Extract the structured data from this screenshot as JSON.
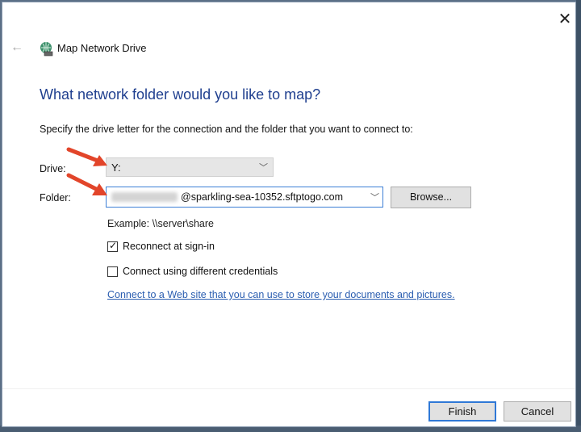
{
  "window": {
    "title": "Map Network Drive",
    "close_glyph": "✕",
    "back_glyph": "←"
  },
  "content": {
    "heading": "What network folder would you like to map?",
    "description": "Specify the drive letter for the connection and the folder that you want to connect to:",
    "drive": {
      "label": "Drive:",
      "value": "Y:"
    },
    "folder": {
      "label": "Folder:",
      "value": "@sparkling-sea-10352.sftptogo.com",
      "browse_label": "Browse..."
    },
    "example": "Example: \\\\server\\share",
    "reconnect": {
      "label": "Reconnect at sign-in",
      "checked": true
    },
    "different_credentials": {
      "label": "Connect using different credentials",
      "checked": false
    },
    "link": "Connect to a Web site that you can use to store your documents and pictures."
  },
  "footer": {
    "finish_label": "Finish",
    "cancel_label": "Cancel"
  },
  "colors": {
    "heading": "#1f3f8f",
    "link": "#2a5db0",
    "focus": "#2f78d6",
    "annotation_arrow": "#e2452a"
  },
  "icons": [
    "close-icon",
    "back-arrow-icon",
    "network-drive-icon",
    "chevron-down-icon",
    "checkmark-icon",
    "red-arrow-annotation"
  ]
}
